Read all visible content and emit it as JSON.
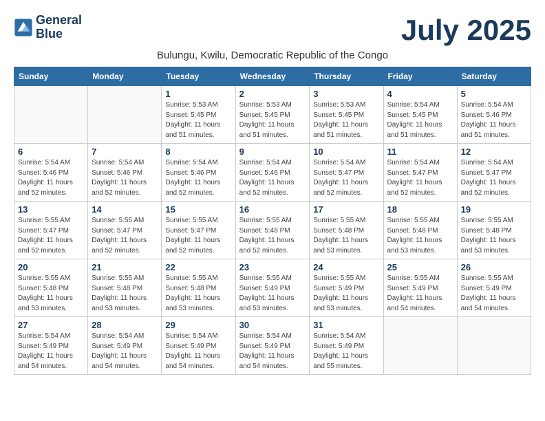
{
  "logo": {
    "line1": "General",
    "line2": "Blue"
  },
  "title": "July 2025",
  "subtitle": "Bulungu, Kwilu, Democratic Republic of the Congo",
  "days_of_week": [
    "Sunday",
    "Monday",
    "Tuesday",
    "Wednesday",
    "Thursday",
    "Friday",
    "Saturday"
  ],
  "weeks": [
    [
      {
        "day": "",
        "detail": ""
      },
      {
        "day": "",
        "detail": ""
      },
      {
        "day": "1",
        "detail": "Sunrise: 5:53 AM\nSunset: 5:45 PM\nDaylight: 11 hours and 51 minutes."
      },
      {
        "day": "2",
        "detail": "Sunrise: 5:53 AM\nSunset: 5:45 PM\nDaylight: 11 hours and 51 minutes."
      },
      {
        "day": "3",
        "detail": "Sunrise: 5:53 AM\nSunset: 5:45 PM\nDaylight: 11 hours and 51 minutes."
      },
      {
        "day": "4",
        "detail": "Sunrise: 5:54 AM\nSunset: 5:45 PM\nDaylight: 11 hours and 51 minutes."
      },
      {
        "day": "5",
        "detail": "Sunrise: 5:54 AM\nSunset: 5:46 PM\nDaylight: 11 hours and 51 minutes."
      }
    ],
    [
      {
        "day": "6",
        "detail": "Sunrise: 5:54 AM\nSunset: 5:46 PM\nDaylight: 11 hours and 52 minutes."
      },
      {
        "day": "7",
        "detail": "Sunrise: 5:54 AM\nSunset: 5:46 PM\nDaylight: 11 hours and 52 minutes."
      },
      {
        "day": "8",
        "detail": "Sunrise: 5:54 AM\nSunset: 5:46 PM\nDaylight: 11 hours and 52 minutes."
      },
      {
        "day": "9",
        "detail": "Sunrise: 5:54 AM\nSunset: 5:46 PM\nDaylight: 11 hours and 52 minutes."
      },
      {
        "day": "10",
        "detail": "Sunrise: 5:54 AM\nSunset: 5:47 PM\nDaylight: 11 hours and 52 minutes."
      },
      {
        "day": "11",
        "detail": "Sunrise: 5:54 AM\nSunset: 5:47 PM\nDaylight: 11 hours and 52 minutes."
      },
      {
        "day": "12",
        "detail": "Sunrise: 5:54 AM\nSunset: 5:47 PM\nDaylight: 11 hours and 52 minutes."
      }
    ],
    [
      {
        "day": "13",
        "detail": "Sunrise: 5:55 AM\nSunset: 5:47 PM\nDaylight: 11 hours and 52 minutes."
      },
      {
        "day": "14",
        "detail": "Sunrise: 5:55 AM\nSunset: 5:47 PM\nDaylight: 11 hours and 52 minutes."
      },
      {
        "day": "15",
        "detail": "Sunrise: 5:55 AM\nSunset: 5:47 PM\nDaylight: 11 hours and 52 minutes."
      },
      {
        "day": "16",
        "detail": "Sunrise: 5:55 AM\nSunset: 5:48 PM\nDaylight: 11 hours and 52 minutes."
      },
      {
        "day": "17",
        "detail": "Sunrise: 5:55 AM\nSunset: 5:48 PM\nDaylight: 11 hours and 53 minutes."
      },
      {
        "day": "18",
        "detail": "Sunrise: 5:55 AM\nSunset: 5:48 PM\nDaylight: 11 hours and 53 minutes."
      },
      {
        "day": "19",
        "detail": "Sunrise: 5:55 AM\nSunset: 5:48 PM\nDaylight: 11 hours and 53 minutes."
      }
    ],
    [
      {
        "day": "20",
        "detail": "Sunrise: 5:55 AM\nSunset: 5:48 PM\nDaylight: 11 hours and 53 minutes."
      },
      {
        "day": "21",
        "detail": "Sunrise: 5:55 AM\nSunset: 5:48 PM\nDaylight: 11 hours and 53 minutes."
      },
      {
        "day": "22",
        "detail": "Sunrise: 5:55 AM\nSunset: 5:48 PM\nDaylight: 11 hours and 53 minutes."
      },
      {
        "day": "23",
        "detail": "Sunrise: 5:55 AM\nSunset: 5:49 PM\nDaylight: 11 hours and 53 minutes."
      },
      {
        "day": "24",
        "detail": "Sunrise: 5:55 AM\nSunset: 5:49 PM\nDaylight: 11 hours and 53 minutes."
      },
      {
        "day": "25",
        "detail": "Sunrise: 5:55 AM\nSunset: 5:49 PM\nDaylight: 11 hours and 54 minutes."
      },
      {
        "day": "26",
        "detail": "Sunrise: 5:55 AM\nSunset: 5:49 PM\nDaylight: 11 hours and 54 minutes."
      }
    ],
    [
      {
        "day": "27",
        "detail": "Sunrise: 5:54 AM\nSunset: 5:49 PM\nDaylight: 11 hours and 54 minutes."
      },
      {
        "day": "28",
        "detail": "Sunrise: 5:54 AM\nSunset: 5:49 PM\nDaylight: 11 hours and 54 minutes."
      },
      {
        "day": "29",
        "detail": "Sunrise: 5:54 AM\nSunset: 5:49 PM\nDaylight: 11 hours and 54 minutes."
      },
      {
        "day": "30",
        "detail": "Sunrise: 5:54 AM\nSunset: 5:49 PM\nDaylight: 11 hours and 54 minutes."
      },
      {
        "day": "31",
        "detail": "Sunrise: 5:54 AM\nSunset: 5:49 PM\nDaylight: 11 hours and 55 minutes."
      },
      {
        "day": "",
        "detail": ""
      },
      {
        "day": "",
        "detail": ""
      }
    ]
  ]
}
